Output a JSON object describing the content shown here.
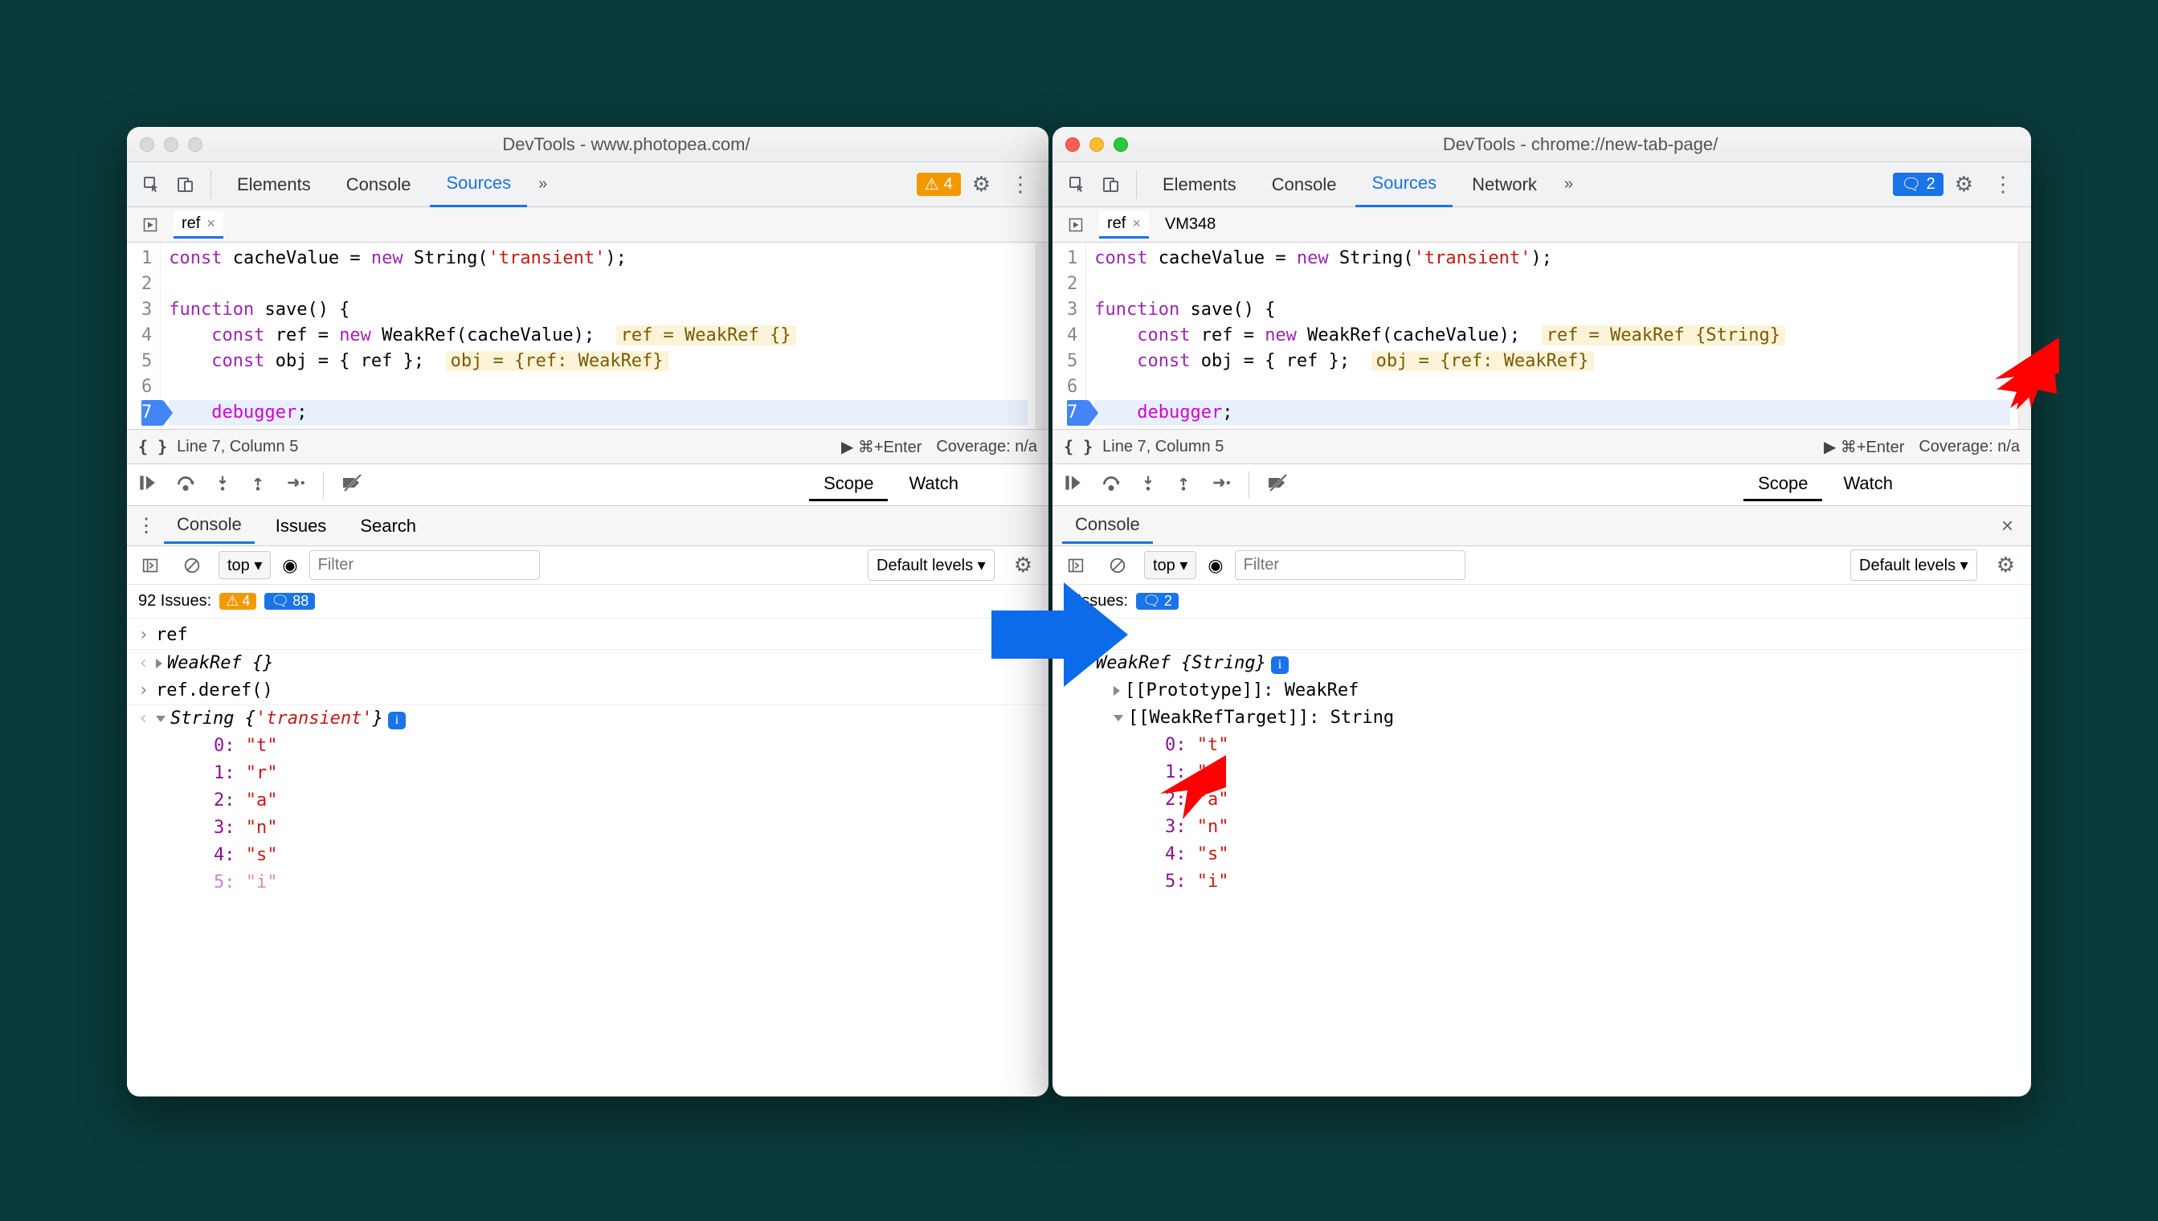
{
  "left": {
    "title": "DevTools - www.photopea.com/",
    "traffic_style": "grey",
    "tabs": [
      "Elements",
      "Console",
      "Sources"
    ],
    "active_tab": "Sources",
    "more": "»",
    "warn_count": "4",
    "file_tabs": {
      "active": "ref",
      "extra": null
    },
    "code": {
      "lines": [
        {
          "n": "1",
          "plain": "const cacheValue = new String('transient');"
        },
        {
          "n": "2",
          "plain": ""
        },
        {
          "n": "3",
          "plain": "function save() {"
        },
        {
          "n": "4",
          "plain": "    const ref = new WeakRef(cacheValue);",
          "hint": "ref = WeakRef {}"
        },
        {
          "n": "5",
          "plain": "    const obj = { ref };",
          "hint": "obj = {ref: WeakRef}"
        },
        {
          "n": "6",
          "plain": ""
        },
        {
          "n": "7",
          "plain": "    debugger;",
          "bp": true,
          "hl": true
        }
      ]
    },
    "status": {
      "pos": "Line 7, Column 5",
      "run": "⌘+Enter",
      "coverage": "Coverage: n/a"
    },
    "scope_tabs": [
      "Scope",
      "Watch"
    ],
    "drawer_tabs": [
      "Console",
      "Issues",
      "Search"
    ],
    "console": {
      "ctx": "top ▾",
      "filter_ph": "Filter",
      "levels": "Default levels ▾",
      "issues_label": "92 Issues:",
      "issues_warn": "4",
      "issues_info": "88",
      "rows": [
        {
          "dir": "in",
          "text": "ref"
        },
        {
          "dir": "out",
          "tree": "closed",
          "italic": true,
          "label": "WeakRef {}"
        },
        {
          "dir": "in",
          "text": "ref.deref()"
        },
        {
          "dir": "out",
          "tree": "open",
          "italic": true,
          "label": "String {",
          "str": "'transient'",
          "after": "}",
          "info": true
        },
        {
          "kv": true,
          "k": "0",
          "v": "\"t\""
        },
        {
          "kv": true,
          "k": "1",
          "v": "\"r\""
        },
        {
          "kv": true,
          "k": "2",
          "v": "\"a\""
        },
        {
          "kv": true,
          "k": "3",
          "v": "\"n\""
        },
        {
          "kv": true,
          "k": "4",
          "v": "\"s\""
        },
        {
          "kv": true,
          "k": "5",
          "v": "\"i\"",
          "cut": true
        }
      ]
    }
  },
  "right": {
    "title": "DevTools - chrome://new-tab-page/",
    "traffic_style": "color",
    "tabs": [
      "Elements",
      "Console",
      "Sources",
      "Network"
    ],
    "active_tab": "Sources",
    "more": "»",
    "info_count": "2",
    "file_tabs": {
      "active": "ref",
      "extra": "VM348"
    },
    "code": {
      "lines": [
        {
          "n": "1",
          "plain": "const cacheValue = new String('transient');"
        },
        {
          "n": "2",
          "plain": ""
        },
        {
          "n": "3",
          "plain": "function save() {"
        },
        {
          "n": "4",
          "plain": "    const ref = new WeakRef(cacheValue);",
          "hint": "ref = WeakRef {String}"
        },
        {
          "n": "5",
          "plain": "    const obj = { ref };",
          "hint": "obj = {ref: WeakRef}"
        },
        {
          "n": "6",
          "plain": ""
        },
        {
          "n": "7",
          "plain": "    debugger;",
          "bp": true,
          "hl": true
        }
      ]
    },
    "status": {
      "pos": "Line 7, Column 5",
      "run": "⌘+Enter",
      "coverage": "Coverage: n/a"
    },
    "scope_tabs": [
      "Scope",
      "Watch"
    ],
    "drawer_tabs": [
      "Console"
    ],
    "console": {
      "ctx": "top ▾",
      "filter_ph": "Filter",
      "levels": "Default levels ▾",
      "issues_label": "2 Issues:",
      "issues_info": "2",
      "rows": [
        {
          "dir": "in",
          "text": "ref"
        },
        {
          "dir": "out",
          "tree": "open",
          "italic": true,
          "label": "WeakRef {String}",
          "info": true
        },
        {
          "sub": true,
          "tree": "closed",
          "label": "[[Prototype]]: ",
          "val": "WeakRef"
        },
        {
          "sub": true,
          "tree": "open",
          "label": "[[WeakRefTarget]]: ",
          "val": "String"
        },
        {
          "kv": true,
          "deep": true,
          "k": "0",
          "v": "\"t\""
        },
        {
          "kv": true,
          "deep": true,
          "k": "1",
          "v": "\"r\""
        },
        {
          "kv": true,
          "deep": true,
          "k": "2",
          "v": "\"a\""
        },
        {
          "kv": true,
          "deep": true,
          "k": "3",
          "v": "\"n\""
        },
        {
          "kv": true,
          "deep": true,
          "k": "4",
          "v": "\"s\""
        },
        {
          "kv": true,
          "deep": true,
          "k": "5",
          "v": "\"i\""
        }
      ]
    }
  }
}
